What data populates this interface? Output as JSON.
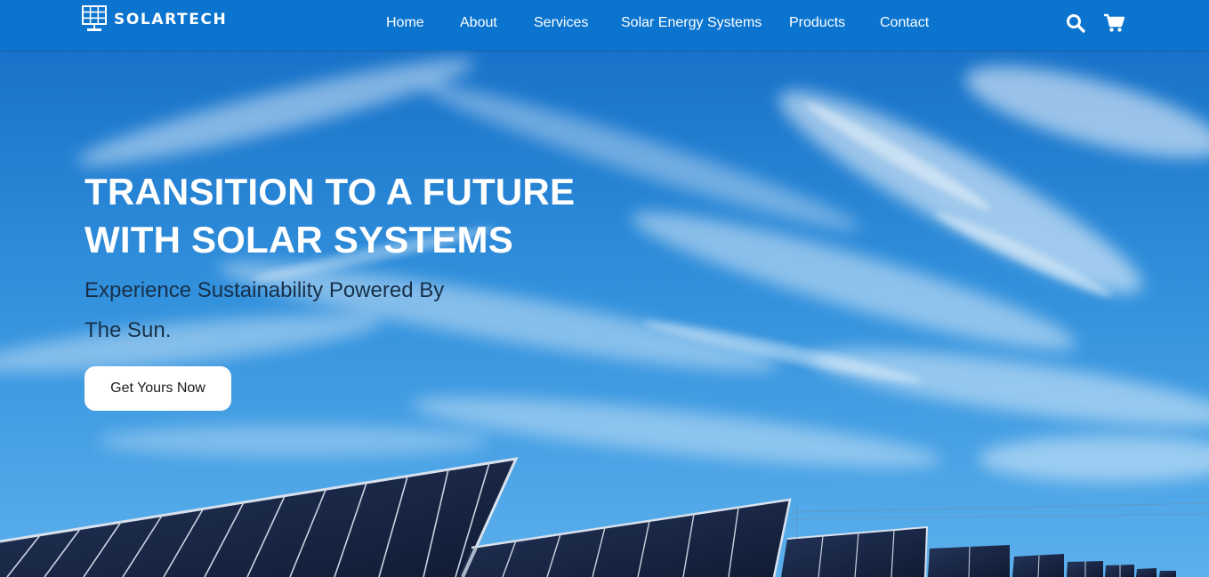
{
  "brand": {
    "name": "SOLARTECH",
    "icon": "solar-panel-icon"
  },
  "nav": {
    "items": [
      {
        "label": "Home"
      },
      {
        "label": "About"
      },
      {
        "label": "Services"
      },
      {
        "label": "Solar Energy Systems"
      },
      {
        "label": "Products"
      },
      {
        "label": "Contact"
      }
    ],
    "search_icon": "search-icon",
    "cart_icon": "cart-icon"
  },
  "hero": {
    "headline_line1": "TRANSITION TO A FUTURE",
    "headline_line2": "WITH SOLAR SYSTEMS",
    "subline_line1": "Experience Sustainability Powered By",
    "subline_line2": "The Sun.",
    "cta_label": "Get Yours Now",
    "background": "blue-sky-with-solar-panels"
  },
  "colors": {
    "header": "#0a74cf",
    "sky": "#2d8ad9",
    "panel": "#1b2a4a",
    "text_light": "#ffffff",
    "text_dark": "#17304a"
  }
}
